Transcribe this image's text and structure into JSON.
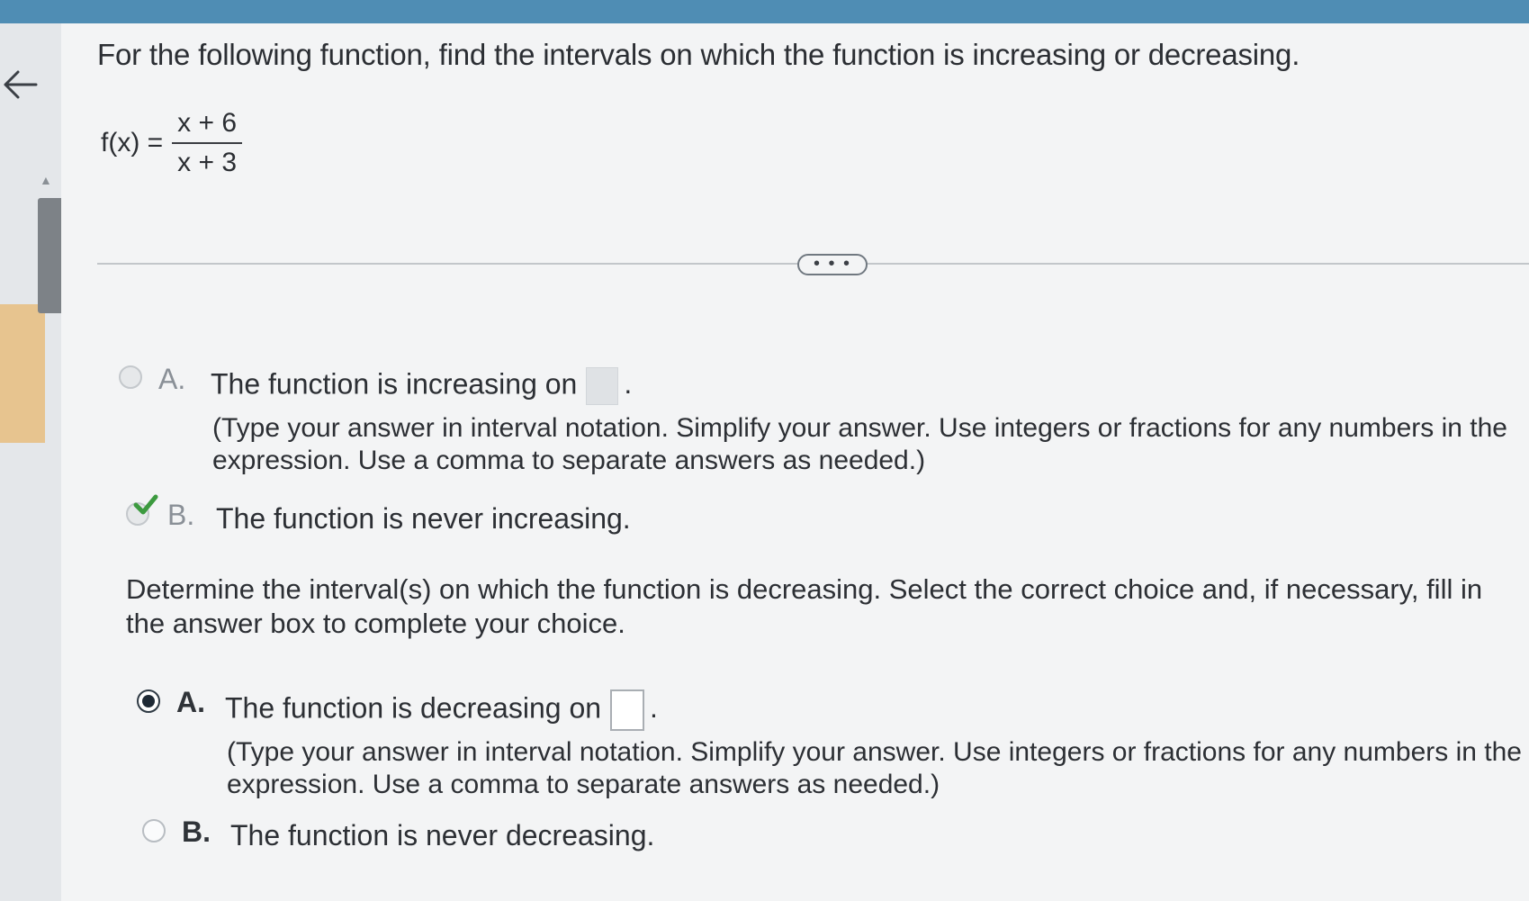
{
  "question": {
    "text": "For the following function, find the intervals on which the function is increasing or decreasing."
  },
  "function": {
    "lhs": "f(x) =",
    "numerator": "x + 6",
    "denominator": "x + 3"
  },
  "more_button": {
    "label": "• • •"
  },
  "increasing": {
    "options": [
      {
        "letter": "A.",
        "text": "The function is increasing on",
        "after_box": ".",
        "hint": "(Type your answer in interval notation. Simplify your answer. Use integers or fractions for any numbers in the expression. Use a comma to separate answers as needed.)"
      },
      {
        "letter": "B.",
        "text": "The function is never increasing."
      }
    ]
  },
  "decreasing": {
    "prompt": "Determine the interval(s) on which the function is decreasing. Select the correct choice and, if necessary, fill in the answer box to complete your choice.",
    "options": [
      {
        "letter": "A.",
        "text": "The function is decreasing on",
        "after_box": ".",
        "hint": "(Type your answer in interval notation. Simplify your answer. Use integers or fractions for any numbers in the expression. Use a comma to separate answers as needed.)"
      },
      {
        "letter": "B.",
        "text": "The function is never decreasing."
      }
    ]
  },
  "state": {
    "increasing_selected": "B",
    "increasing_marked_correct": true,
    "decreasing_selected": "A"
  },
  "colors": {
    "top_bar": "#4f8db4",
    "check_mark": "#3c9a3f",
    "highlight_band": "#e8bd7f"
  }
}
